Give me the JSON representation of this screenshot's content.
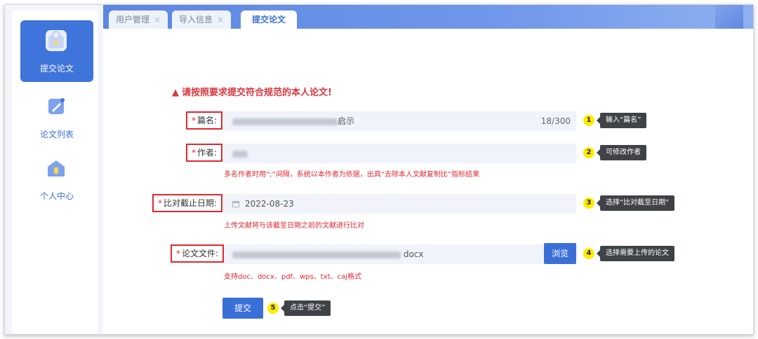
{
  "sidebar": {
    "items": [
      {
        "label": "提交论文",
        "icon": "upload-cloud-icon"
      },
      {
        "label": "论文列表",
        "icon": "edit-document-icon"
      },
      {
        "label": "个人中心",
        "icon": "home-user-icon"
      }
    ]
  },
  "tabs": [
    {
      "label": "用户管理",
      "close": "×"
    },
    {
      "label": "导入信息",
      "close": "×"
    },
    {
      "label": "提交论文"
    }
  ],
  "colors": {
    "accent": "#3b6fd8",
    "required": "#e0262f",
    "step_badge": "#ffeb00",
    "tooltip": "#3f4348"
  },
  "form": {
    "warning": "请按照要求提交符合规范的本人论文!",
    "title": {
      "required": "*",
      "label": "篇名:",
      "value_tail": "启示",
      "counter": "18/300"
    },
    "author": {
      "required": "*",
      "label": "作者:",
      "hint": "多名作者时用“;”间隔，系统以本作者为依据，出具“去除本人文献复制比”指标结果"
    },
    "deadline": {
      "required": "*",
      "label": "比对截止日期:",
      "value": "2022-08-23",
      "hint": "上传文献将与该截至日期之前的文献进行比对"
    },
    "file": {
      "required": "*",
      "label": "论文文件:",
      "value_tail": "docx",
      "browse": "浏览",
      "hint": "支持doc、docx、pdf、wps、txt、caj格式"
    },
    "submit": "提交"
  },
  "steps": [
    {
      "num": "1",
      "tip": "输入“篇名”"
    },
    {
      "num": "2",
      "tip": "可修改作者"
    },
    {
      "num": "3",
      "tip": "选择“比对截至日期”"
    },
    {
      "num": "4",
      "tip": "选择需要上传的论文"
    },
    {
      "num": "5",
      "tip": "点击“提交”"
    }
  ]
}
